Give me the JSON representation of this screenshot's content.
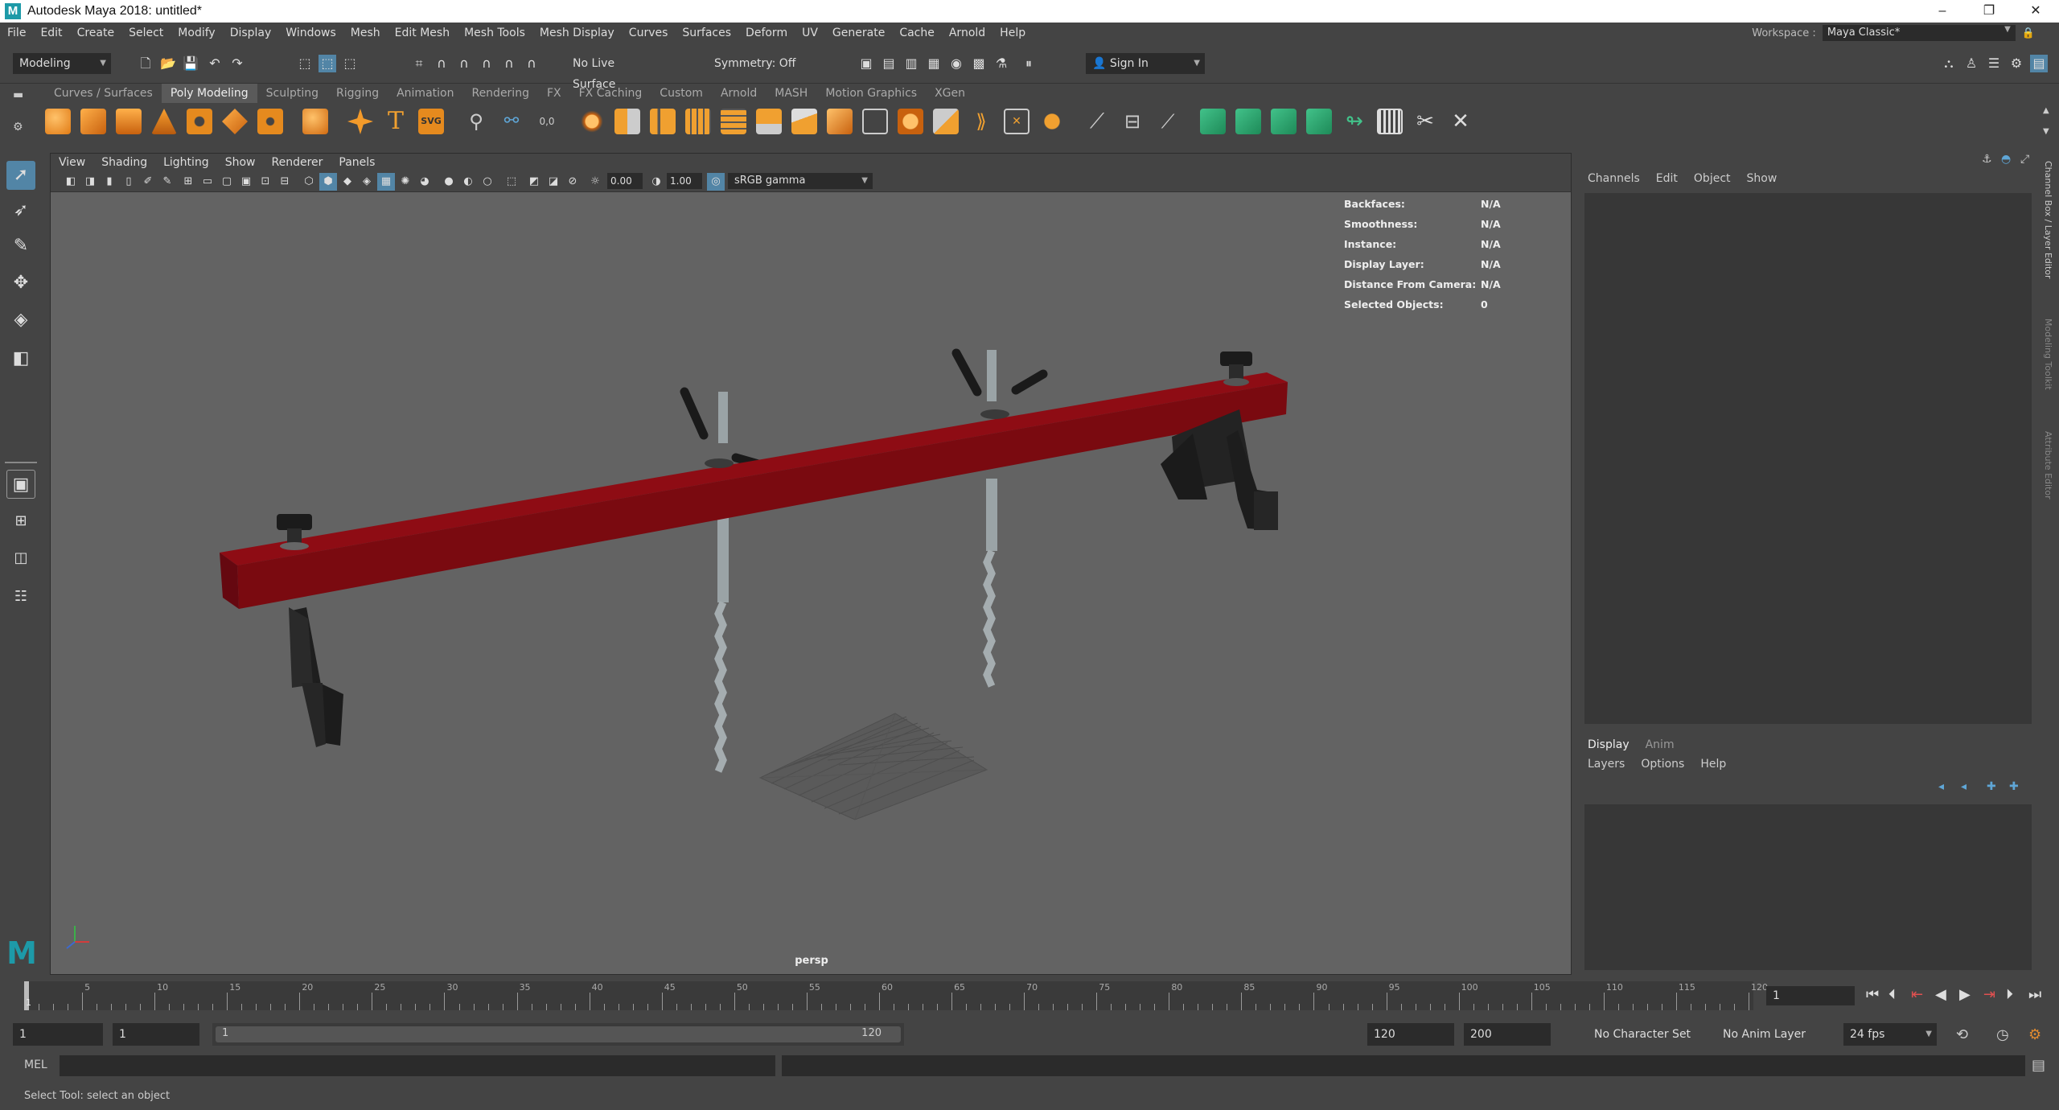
{
  "window": {
    "title": "Autodesk Maya 2018: untitled*",
    "controls": [
      "–",
      "❐",
      "✕"
    ]
  },
  "menus": [
    "File",
    "Edit",
    "Create",
    "Select",
    "Modify",
    "Display",
    "Windows",
    "Mesh",
    "Edit Mesh",
    "Mesh Tools",
    "Mesh Display",
    "Curves",
    "Surfaces",
    "Deform",
    "UV",
    "Generate",
    "Cache",
    "Arnold",
    "Help"
  ],
  "workspace": {
    "label": "Workspace :",
    "value": "Maya Classic*"
  },
  "statusline": {
    "mode": "Modeling",
    "live_surface": "No Live Surface",
    "symmetry": "Symmetry: Off",
    "sign_in": "Sign In"
  },
  "shelf_tabs": [
    "Curves / Surfaces",
    "Poly Modeling",
    "Sculpting",
    "Rigging",
    "Animation",
    "Rendering",
    "FX",
    "FX Caching",
    "Custom",
    "Arnold",
    "MASH",
    "Motion Graphics",
    "XGen"
  ],
  "shelf_active": "Poly Modeling",
  "viewport": {
    "menus": [
      "View",
      "Shading",
      "Lighting",
      "Show",
      "Renderer",
      "Panels"
    ],
    "exposure": "0.00",
    "gamma": "1.00",
    "color_space": "sRGB gamma",
    "camera": "persp",
    "hud": [
      {
        "k": "Backfaces:",
        "v": "N/A"
      },
      {
        "k": "Smoothness:",
        "v": "N/A"
      },
      {
        "k": "Instance:",
        "v": "N/A"
      },
      {
        "k": "Display Layer:",
        "v": "N/A"
      },
      {
        "k": "Distance From Camera:",
        "v": "N/A"
      },
      {
        "k": "Selected Objects:",
        "v": "0"
      }
    ]
  },
  "channel_box": {
    "menus": [
      "Channels",
      "Edit",
      "Object",
      "Show"
    ]
  },
  "layer_editor": {
    "tabs": [
      "Display",
      "Anim"
    ],
    "menus": [
      "Layers",
      "Options",
      "Help"
    ]
  },
  "side_tabs": [
    "Channel Box / Layer Editor",
    "Modeling Toolkit",
    "Attribute Editor"
  ],
  "timeline": {
    "ticks": [
      "5",
      "10",
      "15",
      "20",
      "25",
      "30",
      "35",
      "40",
      "45",
      "50",
      "55",
      "60",
      "65",
      "70",
      "75",
      "80",
      "85",
      "90",
      "95",
      "100",
      "105",
      "110",
      "115",
      "120"
    ],
    "current_marker": "1",
    "current_frame": "1"
  },
  "range": {
    "start": "1",
    "inner_start": "1",
    "slider_start": "1",
    "slider_end": "120",
    "end": "120",
    "max": "200",
    "character_set": "No Character Set",
    "anim_layer": "No Anim Layer",
    "fps": "24 fps"
  },
  "command": {
    "lang": "MEL"
  },
  "help_line": "Select Tool: select an object",
  "colors": {
    "bar": "#7a0a10",
    "bar_top": "#8e0c14",
    "bg": "#444444",
    "viewport": "#636363",
    "accent": "#5285a6"
  },
  "icons": [
    "maya-logo-icon",
    "select-tool-icon",
    "lasso-icon",
    "paint-select-icon",
    "move-tool-icon",
    "rotate-tool-icon",
    "scale-tool-icon"
  ]
}
